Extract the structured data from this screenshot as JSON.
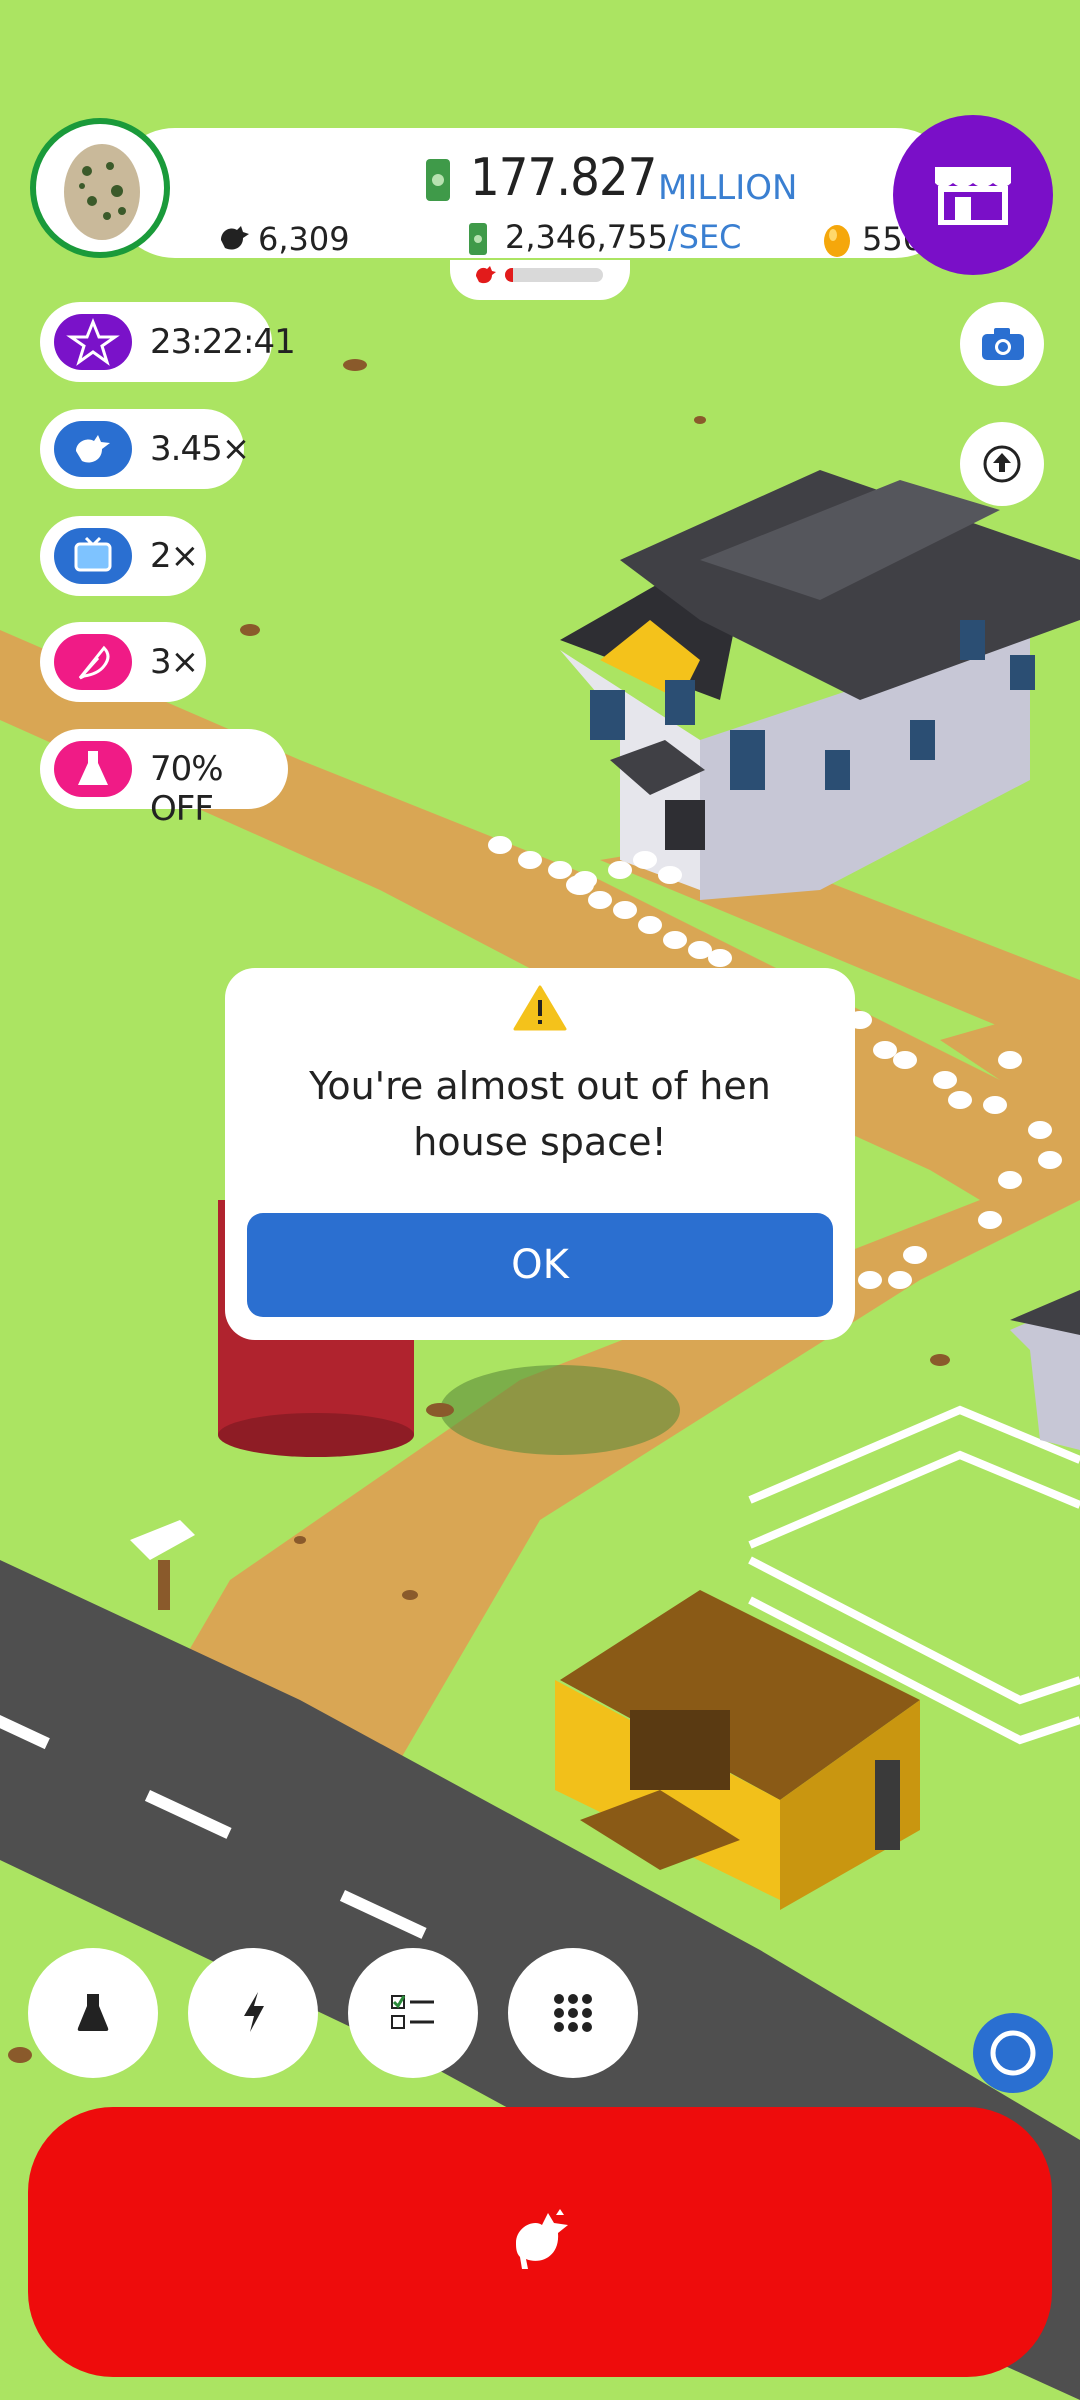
{
  "header": {
    "money_amount": "177.827",
    "money_unit": "MILLION",
    "income_rate": "2,346,755",
    "income_unit": "/SEC",
    "chicken_count": "6,309",
    "golden_egg_count": "556",
    "progress": 0.08
  },
  "boosts": [
    {
      "name": "star-timer",
      "text": "23:22:41",
      "color": "#7a12c9"
    },
    {
      "name": "chicken-multiplier",
      "text": "3.45×",
      "color": "#2a6fd1"
    },
    {
      "name": "tv-multiplier",
      "text": "2×",
      "color": "#2a6fd1"
    },
    {
      "name": "feather-multiplier",
      "text": "3×",
      "color": "#f01b86"
    },
    {
      "name": "research-discount",
      "text": "70% OFF",
      "color": "#f01b86"
    }
  ],
  "dialog": {
    "message": "You're almost out of hen house space!",
    "ok_label": "OK"
  },
  "colors": {
    "grass": "#abe462",
    "road": "#4f4f4f",
    "path": "#d9a654",
    "shop": "#7a0fc8",
    "hatch_button": "#ee0c0c",
    "ok_button": "#2b6fd0"
  }
}
